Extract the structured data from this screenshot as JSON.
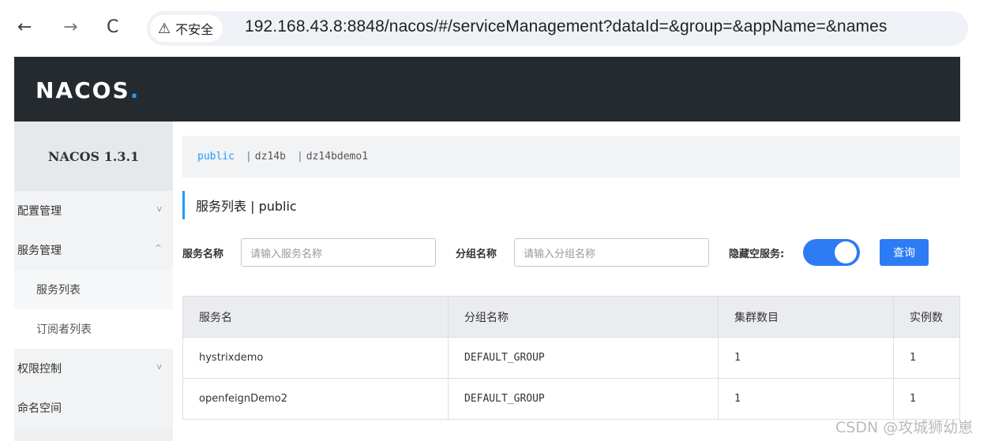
{
  "browser": {
    "back": "←",
    "forward": "→",
    "reload": "C",
    "warn_icon": "⚠",
    "insecure_label": "不安全",
    "url": "192.168.43.8:8848/nacos/#/serviceManagement?dataId=&group=&appName=&names"
  },
  "header": {
    "logo_text": "NACOS",
    "logo_dot": "."
  },
  "sidebar": {
    "version": "NACOS 1.3.1",
    "items": [
      {
        "label": "配置管理",
        "chevron": "v"
      },
      {
        "label": "服务管理",
        "chevron": "^"
      },
      {
        "label": "服务列表"
      },
      {
        "label": "订阅者列表"
      },
      {
        "label": "权限控制",
        "chevron": "v"
      },
      {
        "label": "命名空间"
      }
    ]
  },
  "namespaces": {
    "items": [
      "public",
      "dz14b",
      "dz14bdemo1"
    ],
    "separator": "|",
    "active": "public"
  },
  "page": {
    "title": "服务列表 | public"
  },
  "filters": {
    "service_label": "服务名称",
    "service_placeholder": "请输入服务名称",
    "group_label": "分组名称",
    "group_placeholder": "请输入分组名称",
    "hide_empty_label": "隐藏空服务:",
    "hide_empty_on": true,
    "query_button": "查询"
  },
  "table": {
    "headers": [
      "服务名",
      "分组名称",
      "集群数目",
      "实例数"
    ],
    "rows": [
      [
        "hystrixdemo",
        "DEFAULT_GROUP",
        "1",
        "1"
      ],
      [
        "openfeignDemo2",
        "DEFAULT_GROUP",
        "1",
        "1"
      ]
    ]
  },
  "watermark": "CSDN @攻城狮幼崽",
  "colors": {
    "accent": "#209bfa",
    "button": "#2d7bf5",
    "topbar": "#252a2f"
  }
}
